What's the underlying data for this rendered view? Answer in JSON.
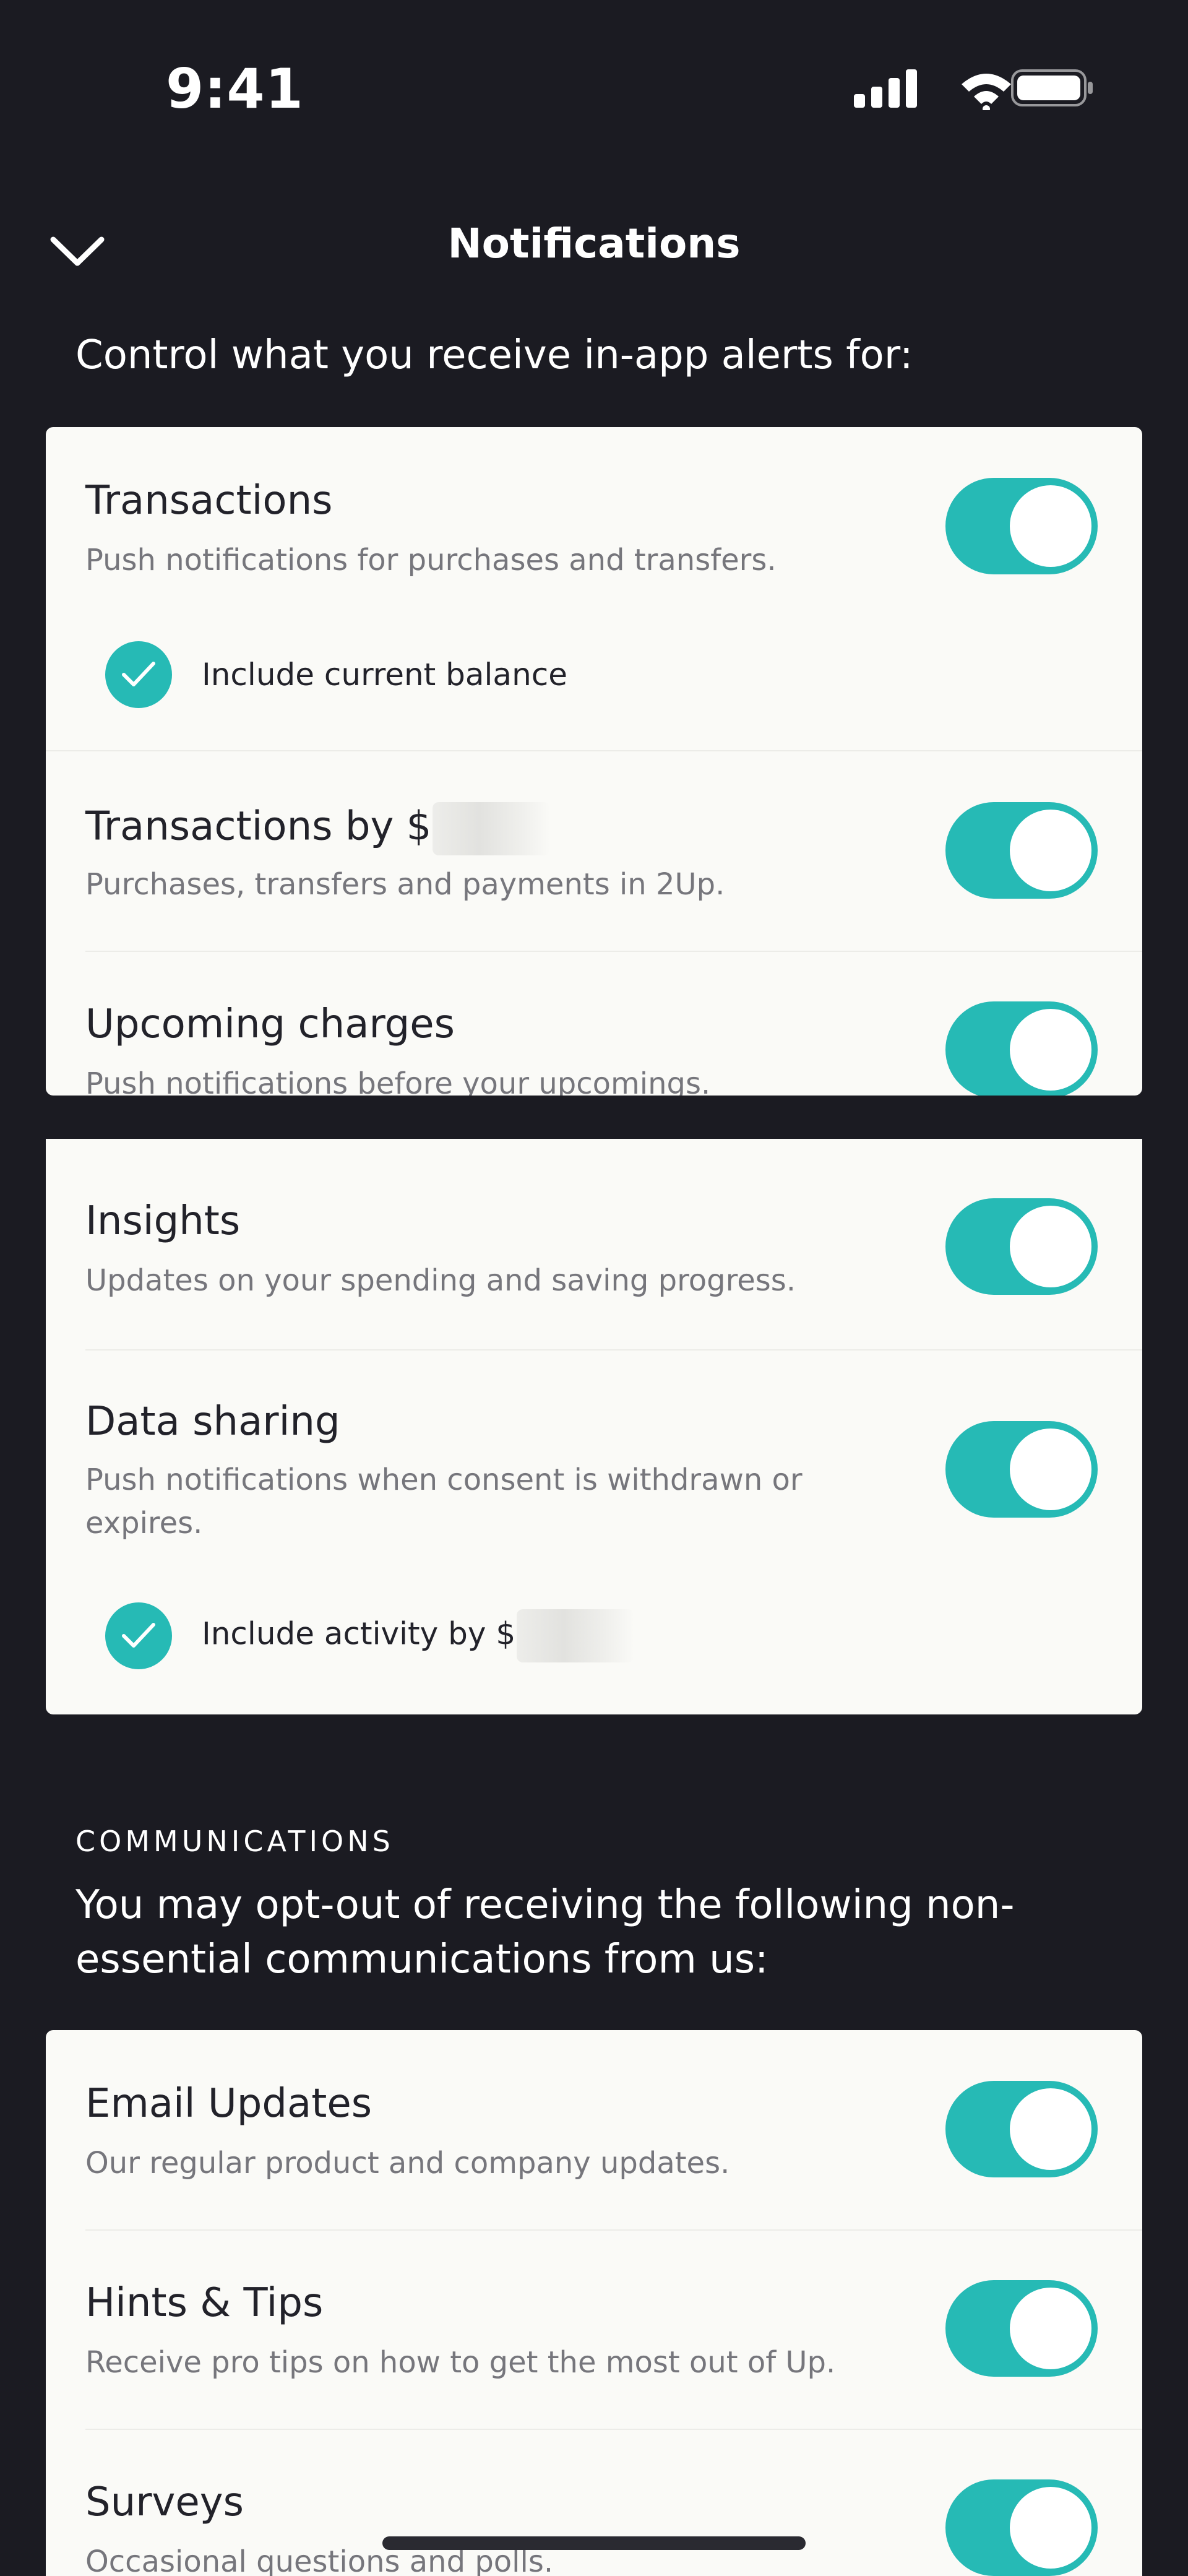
{
  "status_bar": {
    "time": "9:41"
  },
  "nav": {
    "title": "Notifications",
    "back_icon": "chevron-down-icon"
  },
  "alerts": {
    "intro": "Control what you receive in-app alerts for:",
    "items": [
      {
        "title": "Transactions",
        "description": "Push notifications for purchases and transfers.",
        "enabled": true,
        "sub_option": {
          "label": "Include current balance",
          "checked": true
        }
      },
      {
        "title": "Transactions by $",
        "description": "Purchases, transfers and payments in 2Up.",
        "enabled": true
      },
      {
        "title": "Upcoming charges",
        "description": "Push notifications before your upcomings.",
        "enabled": true
      },
      {
        "title": "Insights",
        "description": "Updates on your spending and saving progress.",
        "enabled": true
      },
      {
        "title": "Data sharing",
        "description": "Push notifications when consent is withdrawn or expires.",
        "enabled": true,
        "sub_option": {
          "label": "Include activity by $",
          "checked": true
        }
      }
    ]
  },
  "communications": {
    "heading": "COMMUNICATIONS",
    "intro": "You may opt-out of receiving the following non-essential communications from us:",
    "items": [
      {
        "title": "Email Updates",
        "description": "Our regular product and company updates.",
        "enabled": true
      },
      {
        "title": "Hints & Tips",
        "description": "Receive pro tips on how to get the most out of Up.",
        "enabled": true
      },
      {
        "title": "Surveys",
        "description": "Occasional questions and polls.",
        "enabled": true
      }
    ]
  },
  "colors": {
    "background": "#1B1B22",
    "card": "#FAFAF7",
    "accent": "#26BAB5",
    "title_text": "#22222A",
    "description_text": "#76767C"
  }
}
